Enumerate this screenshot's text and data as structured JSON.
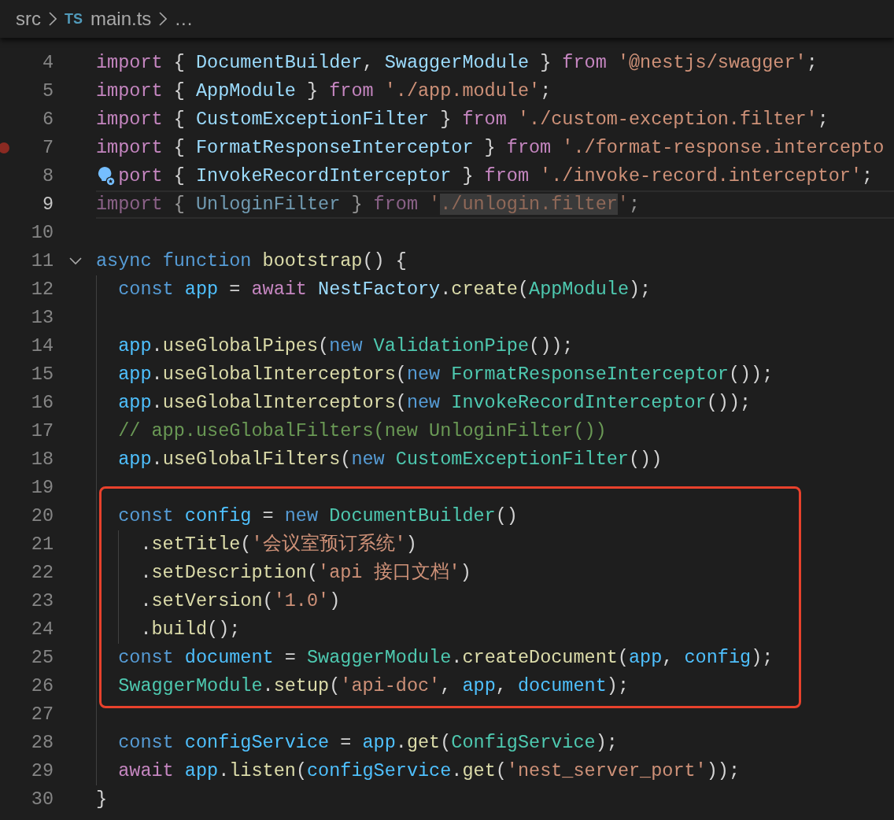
{
  "breadcrumb": {
    "items": [
      {
        "kind": "folder",
        "text": "src"
      },
      {
        "kind": "file",
        "badge": "TS",
        "text": "main.ts"
      },
      {
        "kind": "more",
        "text": "..."
      }
    ]
  },
  "editor": {
    "lines": [
      {
        "kind": "line",
        "number": "4",
        "tokens": [
          {
            "kind": "control",
            "text": "import"
          },
          {
            "kind": "punct",
            "text": " { "
          },
          {
            "kind": "name",
            "text": "DocumentBuilder"
          },
          {
            "kind": "punct",
            "text": ", "
          },
          {
            "kind": "name",
            "text": "SwaggerModule"
          },
          {
            "kind": "punct",
            "text": " } "
          },
          {
            "kind": "control",
            "text": "from "
          },
          {
            "kind": "string",
            "text": "'@nestjs/swagger'"
          },
          {
            "kind": "punct",
            "text": ";"
          }
        ]
      },
      {
        "kind": "line",
        "number": "5",
        "tokens": [
          {
            "kind": "control",
            "text": "import"
          },
          {
            "kind": "punct",
            "text": " { "
          },
          {
            "kind": "name",
            "text": "AppModule"
          },
          {
            "kind": "punct",
            "text": " } "
          },
          {
            "kind": "control",
            "text": "from "
          },
          {
            "kind": "string",
            "text": "'./app.module'"
          },
          {
            "kind": "punct",
            "text": ";"
          }
        ]
      },
      {
        "kind": "line",
        "number": "6",
        "tokens": [
          {
            "kind": "control",
            "text": "import"
          },
          {
            "kind": "punct",
            "text": " { "
          },
          {
            "kind": "name",
            "text": "CustomExceptionFilter"
          },
          {
            "kind": "punct",
            "text": " } "
          },
          {
            "kind": "control",
            "text": "from "
          },
          {
            "kind": "string",
            "text": "'./custom-exception.filter'"
          },
          {
            "kind": "punct",
            "text": ";"
          }
        ]
      },
      {
        "kind": "line",
        "number": "7",
        "breakpoint": true,
        "tokens": [
          {
            "kind": "control",
            "text": "import"
          },
          {
            "kind": "punct",
            "text": " { "
          },
          {
            "kind": "name",
            "text": "FormatResponseInterceptor"
          },
          {
            "kind": "punct",
            "text": " } "
          },
          {
            "kind": "control",
            "text": "from "
          },
          {
            "kind": "string",
            "text": "'./format-response.intercepto"
          }
        ]
      },
      {
        "kind": "line",
        "number": "8",
        "code_action": true,
        "tokens": [
          {
            "kind": "control",
            "text": "port"
          },
          {
            "kind": "punct",
            "text": " { "
          },
          {
            "kind": "name",
            "text": "InvokeRecordInterceptor"
          },
          {
            "kind": "punct",
            "text": " } "
          },
          {
            "kind": "control",
            "text": "from "
          },
          {
            "kind": "string",
            "text": "'./invoke-record.interceptor'"
          },
          {
            "kind": "punct",
            "text": ";"
          }
        ]
      },
      {
        "kind": "line",
        "number": "9",
        "current": true,
        "faded": true,
        "tokens": [
          {
            "kind": "control",
            "text": "import"
          },
          {
            "kind": "punct",
            "text": " { "
          },
          {
            "kind": "name",
            "text": "UnloginFilter"
          },
          {
            "kind": "punct",
            "text": " } "
          },
          {
            "kind": "control",
            "text": "from "
          },
          {
            "kind": "string",
            "text": "'"
          },
          {
            "kind": "string",
            "text": "./unlogin.filter",
            "selected": true
          },
          {
            "kind": "string",
            "text": "'"
          },
          {
            "kind": "punct",
            "text": ";"
          }
        ]
      },
      {
        "kind": "line",
        "number": "10"
      },
      {
        "kind": "line",
        "number": "11",
        "foldable": true,
        "tokens": [
          {
            "kind": "storage",
            "text": "async "
          },
          {
            "kind": "storage",
            "text": "function "
          },
          {
            "kind": "function",
            "text": "bootstrap"
          },
          {
            "kind": "punct",
            "text": "() {"
          }
        ]
      },
      {
        "kind": "line",
        "number": "12",
        "tokens": [
          {
            "kind": "storage",
            "text": "  const "
          },
          {
            "kind": "variable",
            "text": "app"
          },
          {
            "kind": "punct",
            "text": " = "
          },
          {
            "kind": "control",
            "text": "await "
          },
          {
            "kind": "name",
            "text": "NestFactory"
          },
          {
            "kind": "punct",
            "text": "."
          },
          {
            "kind": "function",
            "text": "create"
          },
          {
            "kind": "punct",
            "text": "("
          },
          {
            "kind": "class",
            "text": "AppModule"
          },
          {
            "kind": "punct",
            "text": ");"
          }
        ]
      },
      {
        "kind": "line",
        "number": "13"
      },
      {
        "kind": "line",
        "number": "14",
        "tokens": [
          {
            "kind": "variable",
            "text": "  app"
          },
          {
            "kind": "punct",
            "text": "."
          },
          {
            "kind": "function",
            "text": "useGlobalPipes"
          },
          {
            "kind": "punct",
            "text": "("
          },
          {
            "kind": "storage",
            "text": "new "
          },
          {
            "kind": "class",
            "text": "ValidationPipe"
          },
          {
            "kind": "punct",
            "text": "());"
          }
        ]
      },
      {
        "kind": "line",
        "number": "15",
        "tokens": [
          {
            "kind": "variable",
            "text": "  app"
          },
          {
            "kind": "punct",
            "text": "."
          },
          {
            "kind": "function",
            "text": "useGlobalInterceptors"
          },
          {
            "kind": "punct",
            "text": "("
          },
          {
            "kind": "storage",
            "text": "new "
          },
          {
            "kind": "class",
            "text": "FormatResponseInterceptor"
          },
          {
            "kind": "punct",
            "text": "());"
          }
        ]
      },
      {
        "kind": "line",
        "number": "16",
        "tokens": [
          {
            "kind": "variable",
            "text": "  app"
          },
          {
            "kind": "punct",
            "text": "."
          },
          {
            "kind": "function",
            "text": "useGlobalInterceptors"
          },
          {
            "kind": "punct",
            "text": "("
          },
          {
            "kind": "storage",
            "text": "new "
          },
          {
            "kind": "class",
            "text": "InvokeRecordInterceptor"
          },
          {
            "kind": "punct",
            "text": "());"
          }
        ]
      },
      {
        "kind": "line",
        "number": "17",
        "tokens": [
          {
            "kind": "comment",
            "text": "  // app.useGlobalFilters(new UnloginFilter())"
          }
        ]
      },
      {
        "kind": "line",
        "number": "18",
        "tokens": [
          {
            "kind": "variable",
            "text": "  app"
          },
          {
            "kind": "punct",
            "text": "."
          },
          {
            "kind": "function",
            "text": "useGlobalFilters"
          },
          {
            "kind": "punct",
            "text": "("
          },
          {
            "kind": "storage",
            "text": "new "
          },
          {
            "kind": "class",
            "text": "CustomExceptionFilter"
          },
          {
            "kind": "punct",
            "text": "())"
          }
        ]
      },
      {
        "kind": "line",
        "number": "19"
      },
      {
        "kind": "annotation_box",
        "lines": [
          {
            "kind": "line",
            "number": "20",
            "tokens": [
              {
                "kind": "storage",
                "text": "  const "
              },
              {
                "kind": "variable",
                "text": "config"
              },
              {
                "kind": "punct",
                "text": " = "
              },
              {
                "kind": "storage",
                "text": "new "
              },
              {
                "kind": "class",
                "text": "DocumentBuilder"
              },
              {
                "kind": "punct",
                "text": "()"
              }
            ]
          },
          {
            "kind": "line",
            "number": "21",
            "tokens": [
              {
                "kind": "punct",
                "text": "    ."
              },
              {
                "kind": "function",
                "text": "setTitle"
              },
              {
                "kind": "punct",
                "text": "("
              },
              {
                "kind": "string",
                "text": "'会议室预订系统'"
              },
              {
                "kind": "punct",
                "text": ")"
              }
            ]
          },
          {
            "kind": "line",
            "number": "22",
            "tokens": [
              {
                "kind": "punct",
                "text": "    ."
              },
              {
                "kind": "function",
                "text": "setDescription"
              },
              {
                "kind": "punct",
                "text": "("
              },
              {
                "kind": "string",
                "text": "'api 接口文档'"
              },
              {
                "kind": "punct",
                "text": ")"
              }
            ]
          },
          {
            "kind": "line",
            "number": "23",
            "tokens": [
              {
                "kind": "punct",
                "text": "    ."
              },
              {
                "kind": "function",
                "text": "setVersion"
              },
              {
                "kind": "punct",
                "text": "("
              },
              {
                "kind": "string",
                "text": "'1.0'"
              },
              {
                "kind": "punct",
                "text": ")"
              }
            ]
          },
          {
            "kind": "line",
            "number": "24",
            "tokens": [
              {
                "kind": "punct",
                "text": "    ."
              },
              {
                "kind": "function",
                "text": "build"
              },
              {
                "kind": "punct",
                "text": "();"
              }
            ]
          },
          {
            "kind": "line",
            "number": "25",
            "tokens": [
              {
                "kind": "storage",
                "text": "  const "
              },
              {
                "kind": "variable",
                "text": "document"
              },
              {
                "kind": "punct",
                "text": " = "
              },
              {
                "kind": "class",
                "text": "SwaggerModule"
              },
              {
                "kind": "punct",
                "text": "."
              },
              {
                "kind": "function",
                "text": "createDocument"
              },
              {
                "kind": "punct",
                "text": "("
              },
              {
                "kind": "variable",
                "text": "app"
              },
              {
                "kind": "punct",
                "text": ", "
              },
              {
                "kind": "variable",
                "text": "config"
              },
              {
                "kind": "punct",
                "text": ");"
              }
            ]
          },
          {
            "kind": "line",
            "number": "26",
            "tokens": [
              {
                "kind": "class",
                "text": "  SwaggerModule"
              },
              {
                "kind": "punct",
                "text": "."
              },
              {
                "kind": "function",
                "text": "setup"
              },
              {
                "kind": "punct",
                "text": "("
              },
              {
                "kind": "string",
                "text": "'api-doc'"
              },
              {
                "kind": "punct",
                "text": ", "
              },
              {
                "kind": "variable",
                "text": "app"
              },
              {
                "kind": "punct",
                "text": ", "
              },
              {
                "kind": "variable",
                "text": "document"
              },
              {
                "kind": "punct",
                "text": ");"
              }
            ]
          }
        ]
      },
      {
        "kind": "line",
        "number": "27"
      },
      {
        "kind": "line",
        "number": "28",
        "tokens": [
          {
            "kind": "storage",
            "text": "  const "
          },
          {
            "kind": "variable",
            "text": "configService"
          },
          {
            "kind": "punct",
            "text": " = "
          },
          {
            "kind": "variable",
            "text": "app"
          },
          {
            "kind": "punct",
            "text": "."
          },
          {
            "kind": "function",
            "text": "get"
          },
          {
            "kind": "punct",
            "text": "("
          },
          {
            "kind": "class",
            "text": "ConfigService"
          },
          {
            "kind": "punct",
            "text": ");"
          }
        ]
      },
      {
        "kind": "line",
        "number": "29",
        "tokens": [
          {
            "kind": "control",
            "text": "  await "
          },
          {
            "kind": "variable",
            "text": "app"
          },
          {
            "kind": "punct",
            "text": "."
          },
          {
            "kind": "function",
            "text": "listen"
          },
          {
            "kind": "punct",
            "text": "("
          },
          {
            "kind": "variable",
            "text": "configService"
          },
          {
            "kind": "punct",
            "text": "."
          },
          {
            "kind": "function",
            "text": "get"
          },
          {
            "kind": "punct",
            "text": "("
          },
          {
            "kind": "string",
            "text": "'nest_server_port'"
          },
          {
            "kind": "punct",
            "text": "));"
          }
        ]
      },
      {
        "kind": "line",
        "number": "30",
        "tokens": [
          {
            "kind": "punct",
            "text": "}"
          }
        ]
      }
    ]
  }
}
